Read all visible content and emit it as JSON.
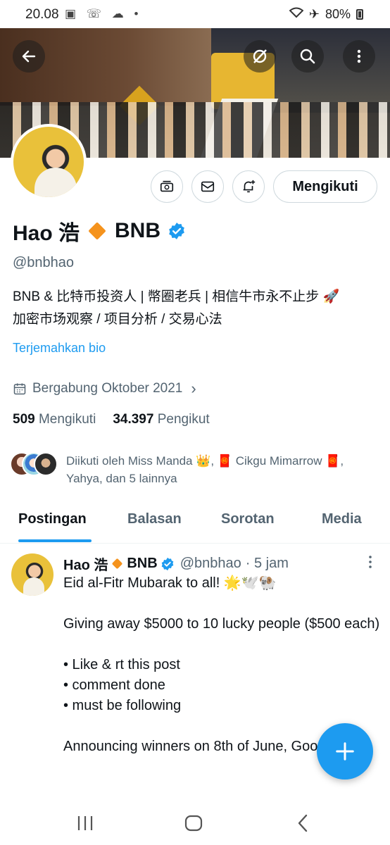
{
  "status_bar": {
    "time": "20.08",
    "battery": "80%"
  },
  "profile": {
    "name": "Hao 浩",
    "name_suffix": "BNB",
    "handle": "@bnbhao",
    "bio_line1": "BNB & 比特币投资人 | 幣圈老兵 | 相信牛市永不止步 🚀",
    "bio_line2": "加密市场观察 / 项目分析 / 交易心法",
    "translate_label": "Terjemahkan bio",
    "joined": "Bergabung Oktober 2021",
    "following_count": "509",
    "following_label": "Mengikuti",
    "followers_count": "34.397",
    "followers_label": "Pengikut",
    "followed_by_line1": "Diikuti oleh Miss Manda 👑, 🧧 Cikgu Mimarrow 🧧,",
    "followed_by_line2": "Yahya, dan 5 lainnya",
    "follow_button": "Mengikuti"
  },
  "tabs": [
    {
      "label": "Postingan",
      "active": true
    },
    {
      "label": "Balasan",
      "active": false
    },
    {
      "label": "Sorotan",
      "active": false
    },
    {
      "label": "Media",
      "active": false
    }
  ],
  "post": {
    "author": "Hao 浩",
    "author_suffix": "BNB",
    "handle": "@bnbhao",
    "time": "· 5 jam",
    "lines": [
      "Eid al-Fitr Mubarak to all! 🌟🕊️🐏",
      "",
      "Giving away $5000 to 10 lucky people ($500 each)",
      "",
      "• Like & rt this post",
      "• comment done",
      "• must be following",
      "",
      "Announcing winners on 8th of June, Good luck!"
    ]
  },
  "colors": {
    "accent": "#1d9bf0",
    "text": "#0f1419",
    "muted": "#536471",
    "bnb": "#f5931d"
  },
  "icons": [
    "back-arrow-icon",
    "grok-icon",
    "search-icon",
    "more-vertical-icon",
    "subscribe-icon",
    "message-icon",
    "notify-add-icon",
    "calendar-icon",
    "verified-icon",
    "compose-plus-icon"
  ]
}
